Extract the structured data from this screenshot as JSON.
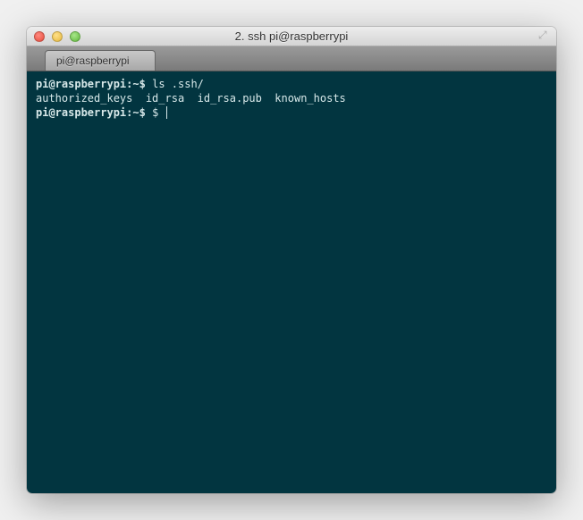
{
  "window": {
    "title": "2. ssh pi@raspberrypi"
  },
  "tab": {
    "label": "pi@raspberrypi"
  },
  "terminal": {
    "lines": [
      {
        "prompt_user": "pi@raspberrypi",
        "prompt_sep": ":",
        "prompt_path": "~",
        "prompt_dollar": "$",
        "command": "ls .ssh/"
      },
      {
        "output": "authorized_keys  id_rsa  id_rsa.pub  known_hosts"
      },
      {
        "prompt_user": "pi@raspberrypi",
        "prompt_sep": ":",
        "prompt_path": "~",
        "prompt_dollar": "$",
        "command": "$ ",
        "cursor": true
      }
    ]
  },
  "colors": {
    "terminal_bg": "#023540",
    "terminal_fg": "#d7e8e9"
  }
}
